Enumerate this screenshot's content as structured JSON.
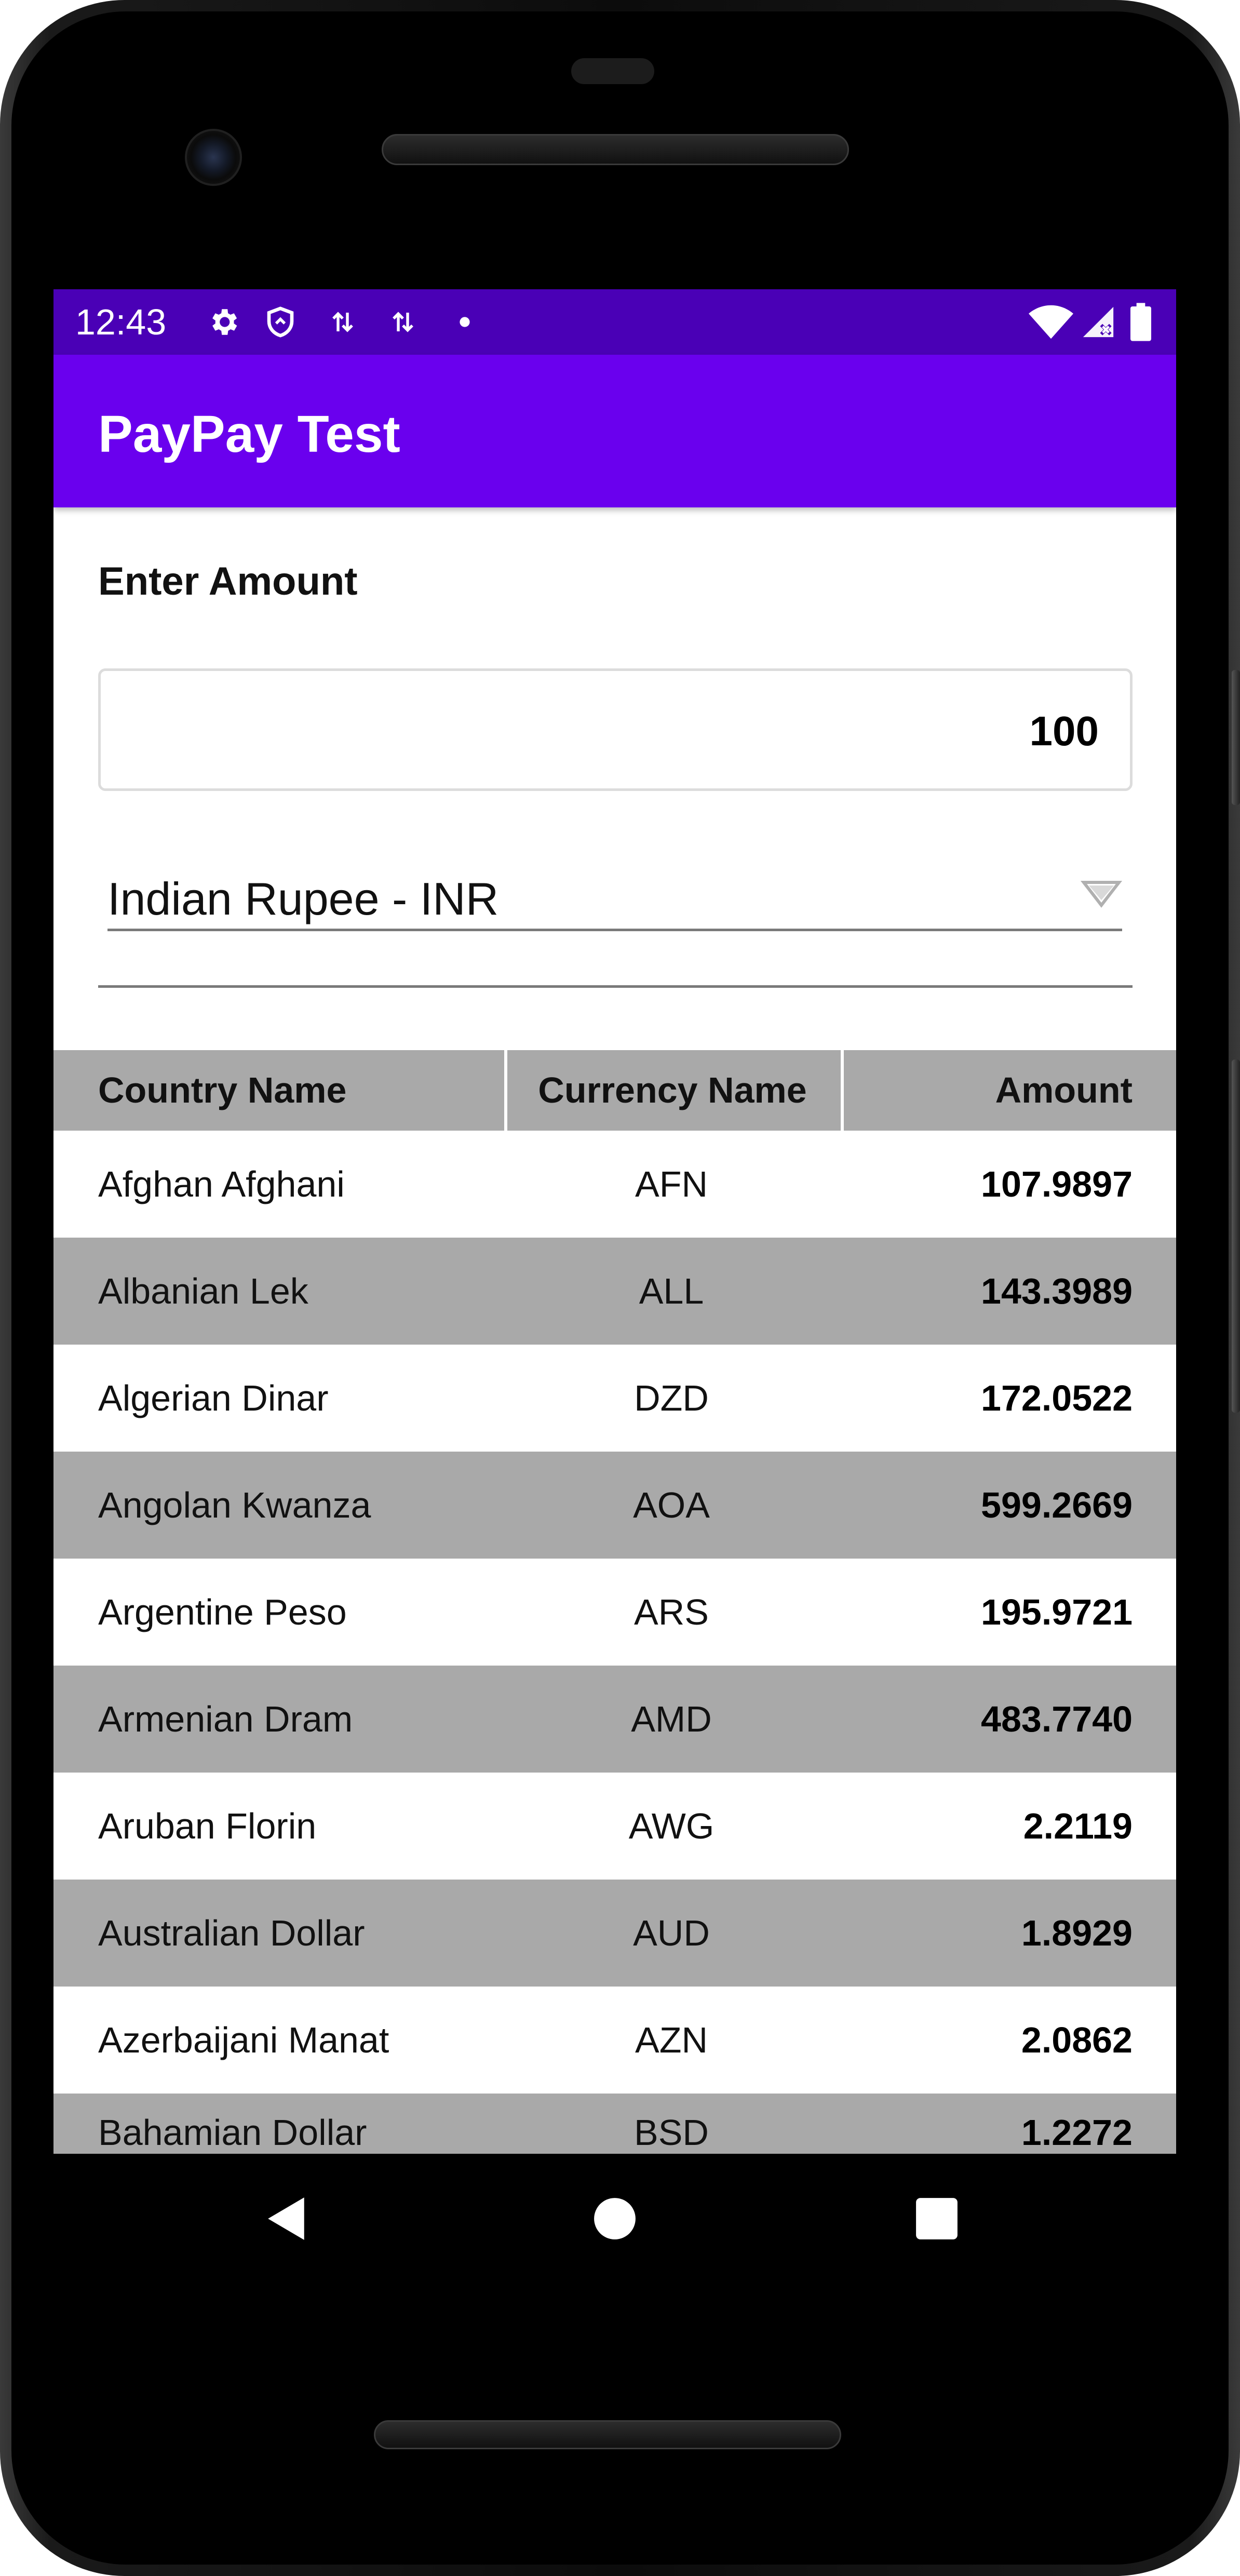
{
  "status_bar": {
    "time": "12:43",
    "icons": [
      "gear-icon",
      "shield-icon",
      "data-transfer-icon",
      "data-transfer-icon",
      "dot-icon"
    ],
    "right_icons": [
      "wifi-icon",
      "cell-signal-icon",
      "battery-icon"
    ]
  },
  "app_bar": {
    "title": "PayPay Test"
  },
  "form": {
    "amount_label": "Enter Amount",
    "amount_value": "100",
    "currency_selected": "Indian Rupee - INR"
  },
  "table": {
    "headers": {
      "country": "Country Name",
      "currency": "Currency Name",
      "amount": "Amount"
    },
    "rows": [
      {
        "country": "Afghan Afghani",
        "code": "AFN",
        "amount": "107.9897"
      },
      {
        "country": "Albanian Lek",
        "code": "ALL",
        "amount": "143.3989"
      },
      {
        "country": "Algerian Dinar",
        "code": "DZD",
        "amount": "172.0522"
      },
      {
        "country": "Angolan Kwanza",
        "code": "AOA",
        "amount": "599.2669"
      },
      {
        "country": "Argentine Peso",
        "code": "ARS",
        "amount": "195.9721"
      },
      {
        "country": "Armenian Dram",
        "code": "AMD",
        "amount": "483.7740"
      },
      {
        "country": "Aruban Florin",
        "code": "AWG",
        "amount": "2.2119"
      },
      {
        "country": "Australian Dollar",
        "code": "AUD",
        "amount": "1.8929"
      },
      {
        "country": "Azerbaijani Manat",
        "code": "AZN",
        "amount": "2.0862"
      },
      {
        "country": "Bahamian Dollar",
        "code": "BSD",
        "amount": "1.2272"
      }
    ]
  },
  "nav_bar": {
    "buttons": [
      "back-icon",
      "home-icon",
      "recents-icon"
    ]
  },
  "colors": {
    "status_bar": "#4a00b6",
    "app_bar": "#6a00ee",
    "row_alt": "#a9a9a9"
  }
}
